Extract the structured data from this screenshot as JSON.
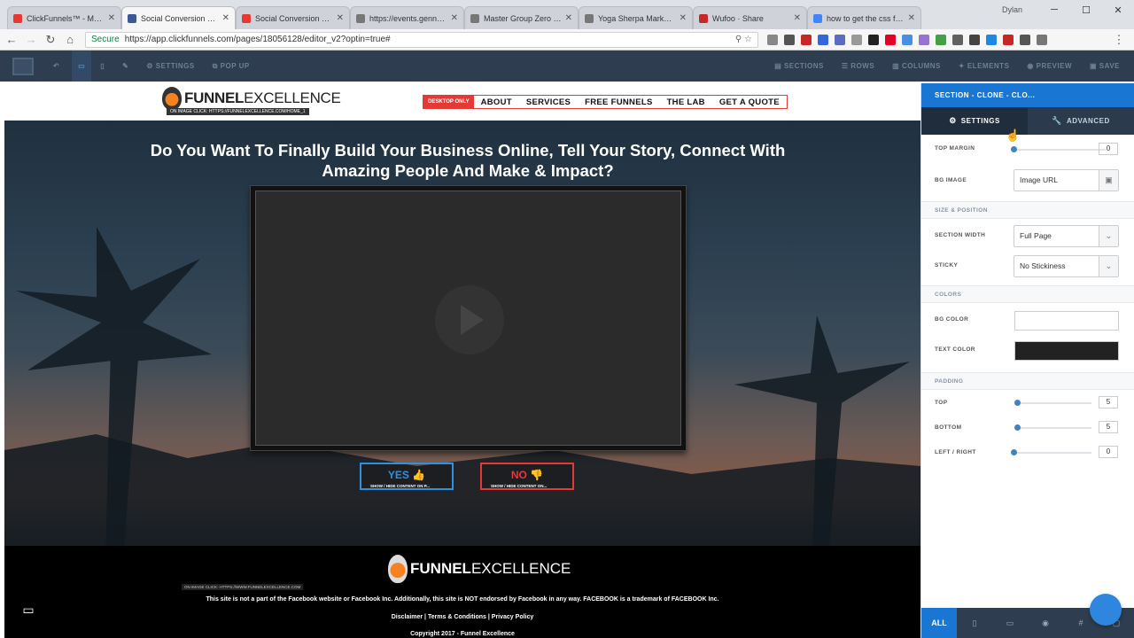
{
  "browser": {
    "tabs": [
      {
        "title": "ClickFunnels™ - Marketi",
        "color": "#e53935"
      },
      {
        "title": "Social Conversion Machi",
        "color": "#3b5998",
        "active": true
      },
      {
        "title": "Social Conversion Machi",
        "color": "#e53935"
      },
      {
        "title": "https://events.genndi.co",
        "color": "#777777"
      },
      {
        "title": "Master Group Zero to 6f",
        "color": "#777777"
      },
      {
        "title": "Yoga Sherpa Marketing",
        "color": "#777777"
      },
      {
        "title": "Wufoo · Share",
        "color": "#c62828"
      },
      {
        "title": "how to get the css for a",
        "color": "#4285f4"
      }
    ],
    "user": "Dylan",
    "secure_label": "Secure",
    "url": "https://app.clickfunnels.com/pages/18056128/editor_v2?optin=true#"
  },
  "toolbar": {
    "settings": "SETTINGS",
    "popup": "POP UP",
    "sections": "SECTIONS",
    "rows": "ROWS",
    "columns": "COLUMNS",
    "elements": "ELEMENTS",
    "preview": "PREVIEW",
    "save": "SAVE"
  },
  "site": {
    "brand_bold": "FUNNEL",
    "brand_light": "EXCELLENCE",
    "brand_tag": "ON IMAGE CLICK: HTTPS://FUNNELEXCELLENCE.COM/HOME_1",
    "desktop_only": "DESKTOP ONLY",
    "nav": [
      "ABOUT",
      "SERVICES",
      "FREE FUNNELS",
      "THE LAB",
      "GET A QUOTE"
    ],
    "headline": "Do You Want To Finally Build Your Business Online, Tell Your Story, Connect With Amazing People And Make & Impact?",
    "yes_label": "YES",
    "no_label": "NO",
    "yes_sub": "SHOW / HIDE CONTENT ON P...",
    "no_sub": "SHOW / HIDE CONTENT ON...",
    "footer_tag": "ON IMAGE CLICK: HTTPS://WWW.FUNNELEXCELLENCE.COM",
    "disclaimer": "This site is not a part of the Facebook website or Facebook Inc. Additionally, this site is NOT endorsed by Facebook in any way. FACEBOOK is a trademark of FACEBOOK Inc.",
    "footer_links": "Disclaimer | Terms & Conditions | Privacy Policy",
    "copyright": "Copyright 2017 - Funnel Excellence"
  },
  "panel": {
    "title": "SECTION - CLONE - CLO...",
    "tab_settings": "SETTINGS",
    "tab_advanced": "ADVANCED",
    "top_margin_label": "TOP MARGIN",
    "top_margin": "0",
    "bg_image_label": "BG IMAGE",
    "bg_image_placeholder": "Image URL",
    "size_section": "SIZE & POSITION",
    "section_width_label": "SECTION WIDTH",
    "section_width": "Full Page",
    "sticky_label": "STICKY",
    "sticky": "No Stickiness",
    "colors_section": "COLORS",
    "bg_color_label": "BG COLOR",
    "bg_color": "#ffffff",
    "text_color_label": "TEXT COLOR",
    "text_color": "#222222",
    "padding_section": "PADDING",
    "top_label": "TOP",
    "top": "5",
    "bottom_label": "BOTTOM",
    "bottom": "5",
    "lr_label": "LEFT / RIGHT",
    "lr": "0",
    "footer_all": "ALL"
  }
}
